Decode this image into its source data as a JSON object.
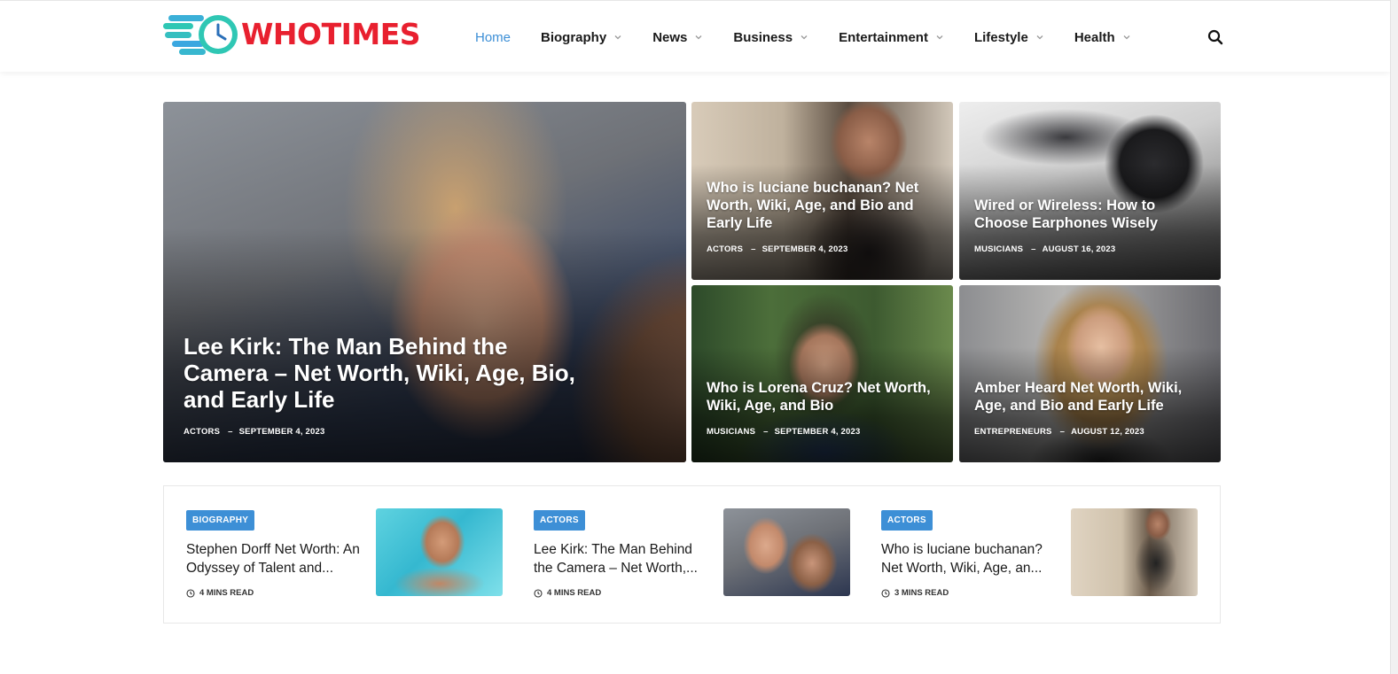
{
  "site": {
    "logo_text": "WHOTIMES"
  },
  "colors": {
    "accent": "#3d8fd6",
    "brand_red": "#e8202f",
    "logo_teal": "#2fc7b4"
  },
  "nav": {
    "items": [
      {
        "label": "Home",
        "active": true
      },
      {
        "label": "Biography"
      },
      {
        "label": "News"
      },
      {
        "label": "Business"
      },
      {
        "label": "Entertainment"
      },
      {
        "label": "Lifestyle"
      },
      {
        "label": "Health"
      }
    ],
    "search_icon": "search-icon"
  },
  "hero": {
    "main": {
      "title": "Lee Kirk: The Man Behind the Camera – Net Worth, Wiki, Age, Bio, and Early Life",
      "category": "ACTORS",
      "date": "SEPTEMBER 4, 2023"
    },
    "tiles": [
      {
        "title": "Who is luciane buchanan? Net Worth, Wiki, Age, and Bio and Early Life",
        "category": "ACTORS",
        "date": "SEPTEMBER 4, 2023"
      },
      {
        "title": "Wired or Wireless: How to Choose Earphones Wisely",
        "category": "MUSICIANS",
        "date": "AUGUST 16, 2023"
      },
      {
        "title": "Who is Lorena Cruz? Net Worth, Wiki, Age, and Bio",
        "category": "MUSICIANS",
        "date": "SEPTEMBER 4, 2023"
      },
      {
        "title": "Amber Heard Net Worth, Wiki, Age, and Bio and Early Life",
        "category": "ENTREPRENEURS",
        "date": "AUGUST 12, 2023"
      }
    ]
  },
  "strip": {
    "cards": [
      {
        "badge": "BIOGRAPHY",
        "title": "Stephen Dorff Net Worth: An Odyssey of Talent and...",
        "read": "4 MINS READ"
      },
      {
        "badge": "ACTORS",
        "title": "Lee Kirk: The Man Behind the Camera – Net Worth,...",
        "read": "4 MINS READ"
      },
      {
        "badge": "ACTORS",
        "title": "Who is luciane buchanan? Net Worth, Wiki, Age, an...",
        "read": "3 MINS READ"
      }
    ]
  }
}
